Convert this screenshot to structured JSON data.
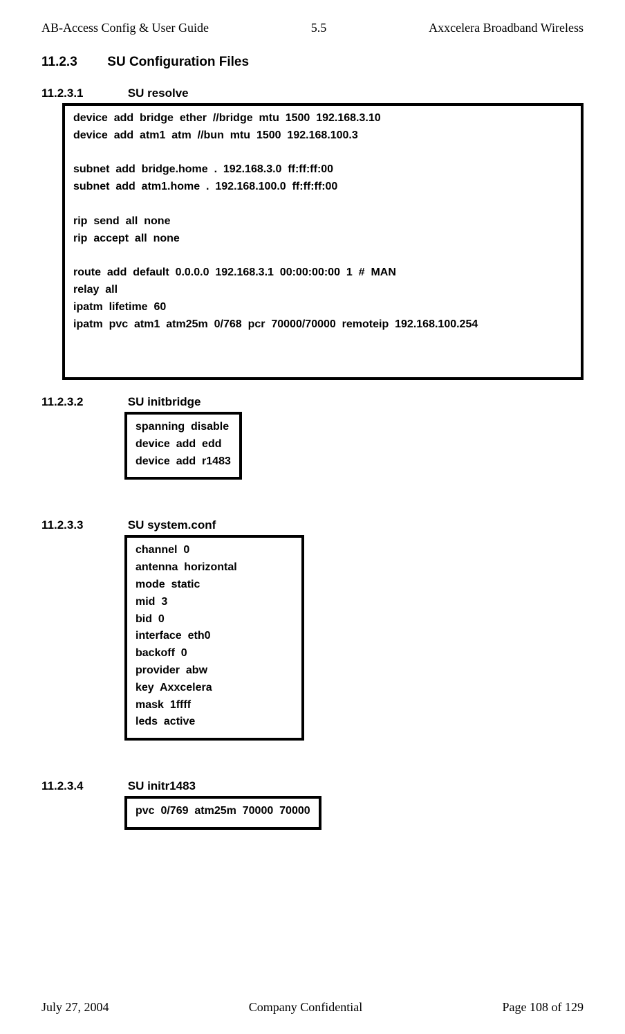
{
  "header": {
    "left": "AB-Access Config & User Guide",
    "center": "5.5",
    "right": "Axxcelera Broadband Wireless"
  },
  "sec11_2_3": {
    "num": "11.2.3",
    "title": "SU Configuration Files"
  },
  "sec1": {
    "num": "11.2.3.1",
    "title": "SU resolve",
    "code": "device  add  bridge  ether  //bridge  mtu  1500  192.168.3.10\ndevice  add  atm1  atm  //bun  mtu  1500  192.168.100.3\n\nsubnet  add  bridge.home  .  192.168.3.0  ff:ff:ff:00\nsubnet  add  atm1.home  .  192.168.100.0  ff:ff:ff:00\n\nrip  send  all  none\nrip  accept  all  none\n\nroute  add  default  0.0.0.0  192.168.3.1  00:00:00:00  1  #  MAN\nrelay  all\nipatm  lifetime  60\nipatm  pvc  atm1  atm25m  0/768  pcr  70000/70000  remoteip  192.168.100.254"
  },
  "sec2": {
    "num": "11.2.3.2",
    "title": "SU initbridge",
    "code": "spanning  disable\ndevice  add  edd\ndevice  add  r1483"
  },
  "sec3": {
    "num": "11.2.3.3",
    "title": "SU system.conf",
    "code": "channel  0\nantenna  horizontal\nmode  static\nmid  3\nbid  0\ninterface  eth0\nbackoff  0\nprovider  abw\nkey  Axxcelera\nmask  1ffff\nleds  active"
  },
  "sec4": {
    "num": "11.2.3.4",
    "title": "SU initr1483",
    "code": "pvc  0/769  atm25m  70000  70000"
  },
  "footer": {
    "left": "July 27, 2004",
    "center": "Company Confidential",
    "right": "Page 108 of 129"
  }
}
